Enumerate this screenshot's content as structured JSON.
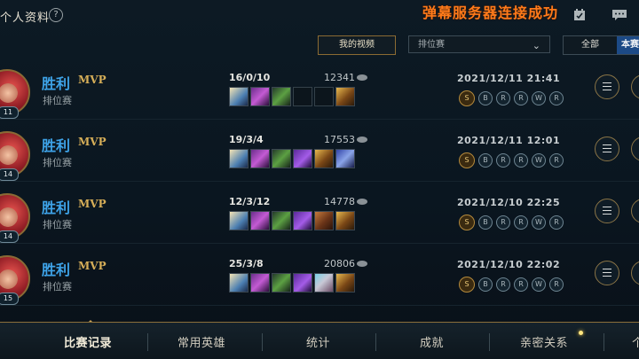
{
  "header": {
    "title": "个人资料",
    "help_label": "?",
    "danmaku_status": "弹幕服务器连接成功"
  },
  "filters": {
    "videos_button": "我的视频",
    "mode_select": "排位赛",
    "seg_all": "全部",
    "seg_this": "本赛"
  },
  "matches": [
    {
      "result": "胜利",
      "badge": "MVP",
      "mode": "排位赛",
      "level": "11",
      "kda": "16/0/10",
      "gold": "12341",
      "datetime": "2021/12/11 21:41",
      "items": [
        "boots",
        "purple",
        "green",
        "empty",
        "empty",
        "gold"
      ],
      "runes": [
        "S",
        "B",
        "R",
        "R",
        "W",
        "R"
      ]
    },
    {
      "result": "胜利",
      "badge": "MVP",
      "mode": "排位赛",
      "level": "14",
      "kda": "19/3/4",
      "gold": "17553",
      "datetime": "2021/12/11 12:01",
      "items": [
        "boots",
        "purple",
        "green",
        "violet",
        "gold",
        "blue"
      ],
      "runes": [
        "S",
        "B",
        "R",
        "R",
        "W",
        "R"
      ]
    },
    {
      "result": "胜利",
      "badge": "MVP",
      "mode": "排位赛",
      "level": "14",
      "kda": "12/3/12",
      "gold": "14778",
      "datetime": "2021/12/10 22:25",
      "items": [
        "boots",
        "purple",
        "green",
        "violet",
        "book",
        "gold"
      ],
      "runes": [
        "S",
        "B",
        "R",
        "R",
        "W",
        "R"
      ]
    },
    {
      "result": "胜利",
      "badge": "MVP",
      "mode": "排位赛",
      "level": "15",
      "kda": "25/3/8",
      "gold": "20806",
      "datetime": "2021/12/10 22:02",
      "items": [
        "boots",
        "purple",
        "green",
        "violet",
        "cat",
        "gold"
      ],
      "runes": [
        "S",
        "B",
        "R",
        "R",
        "W",
        "R"
      ]
    }
  ],
  "nav": {
    "tabs": [
      "比赛记录",
      "常用英雄",
      "统计",
      "成就",
      "亲密关系",
      "个"
    ]
  },
  "colors": {
    "accent": "#d6ae58",
    "win": "#3ea3e8",
    "danmaku": "#ff7a1a",
    "selected_seg": "#1c4a86"
  }
}
